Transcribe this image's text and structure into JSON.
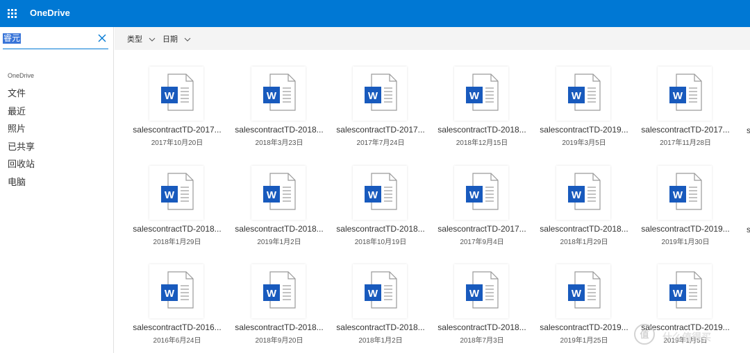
{
  "app": {
    "brand": "OneDrive",
    "accent_color": "#0078d4"
  },
  "search": {
    "value": "睿元"
  },
  "sidebar": {
    "heading": "OneDrive",
    "items": [
      {
        "label": "文件"
      },
      {
        "label": "最近"
      },
      {
        "label": "照片"
      },
      {
        "label": "已共享"
      },
      {
        "label": "回收站"
      },
      {
        "label": "电脑"
      }
    ]
  },
  "toolbar": {
    "type_label": "类型",
    "date_label": "日期"
  },
  "files": [
    {
      "name": "salescontractTD-2017...",
      "date": "2017年10月20日"
    },
    {
      "name": "salescontractTD-2018...",
      "date": "2018年3月23日"
    },
    {
      "name": "salescontractTD-2017...",
      "date": "2017年7月24日"
    },
    {
      "name": "salescontractTD-2018...",
      "date": "2018年12月15日"
    },
    {
      "name": "salescontractTD-2019...",
      "date": "2019年3月5日"
    },
    {
      "name": "salescontractTD-2017...",
      "date": "2017年11月28日"
    },
    {
      "name": "salescontractTD-2018...",
      "date": "2018年1月29日"
    },
    {
      "name": "salescontractTD-2018...",
      "date": "2019年1月2日"
    },
    {
      "name": "salescontractTD-2018...",
      "date": "2018年10月19日"
    },
    {
      "name": "salescontractTD-2017...",
      "date": "2017年9月4日"
    },
    {
      "name": "salescontractTD-2018...",
      "date": "2018年1月29日"
    },
    {
      "name": "salescontractTD-2019...",
      "date": "2019年1月30日"
    },
    {
      "name": "salescontractTD-2016...",
      "date": "2016年6月24日"
    },
    {
      "name": "salescontractTD-2018...",
      "date": "2018年9月20日"
    },
    {
      "name": "salescontractTD-2018...",
      "date": "2018年1月2日"
    },
    {
      "name": "salescontractTD-2018...",
      "date": "2018年7月3日"
    },
    {
      "name": "salescontractTD-2019...",
      "date": "2019年1月25日"
    },
    {
      "name": "salescontractTD-2019...",
      "date": "2019年1月5日"
    }
  ],
  "watermark": {
    "text": "什么值得买"
  }
}
